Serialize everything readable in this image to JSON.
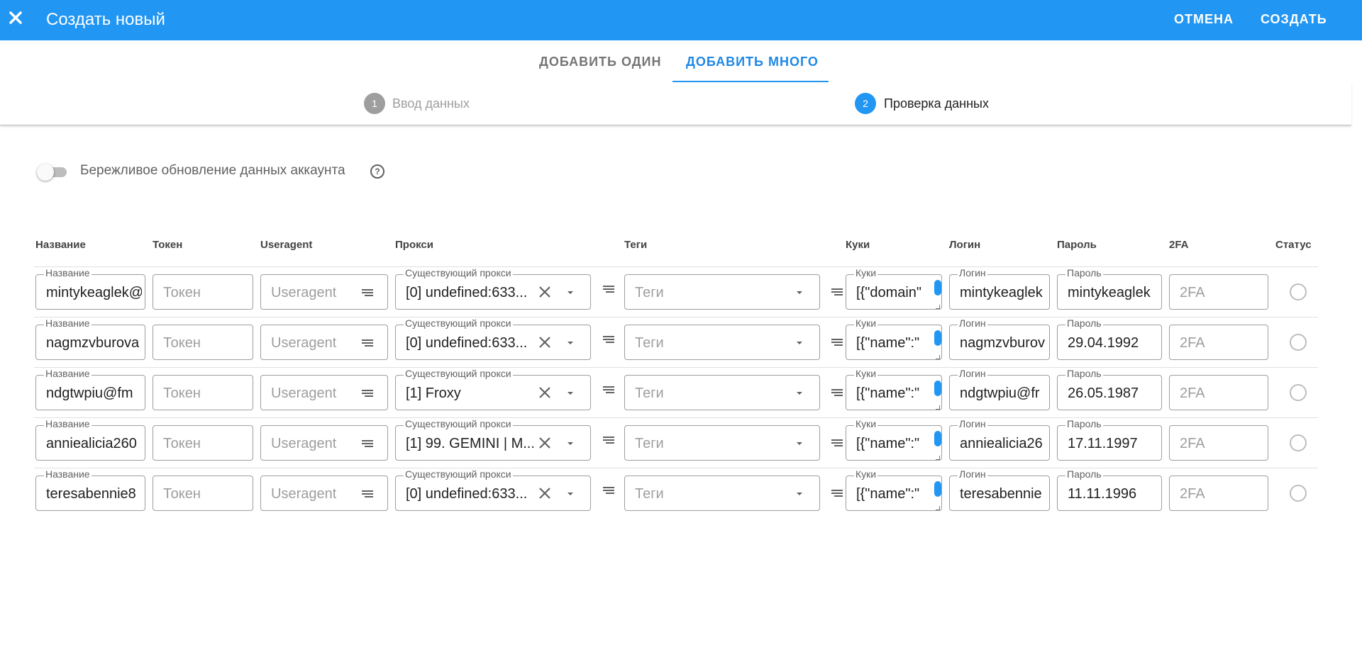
{
  "header": {
    "title": "Создать новый",
    "cancel_label": "ОТМЕНА",
    "create_label": "СОЗДАТЬ"
  },
  "tabs": [
    {
      "label": "ДОБАВИТЬ ОДИН",
      "active": false
    },
    {
      "label": "ДОБАВИТЬ МНОГО",
      "active": true
    }
  ],
  "stepper": [
    {
      "number": "1",
      "label": "Ввод данных",
      "active": false
    },
    {
      "number": "2",
      "label": "Проверка данных",
      "active": true
    }
  ],
  "settings": {
    "toggle_label": "Бережливое обновление данных аккаунта",
    "toggle_on": false,
    "help_glyph": "?"
  },
  "table": {
    "headers": [
      "Название",
      "Токен",
      "Useragent",
      "Прокси",
      "Теги",
      "Куки",
      "Логин",
      "Пароль",
      "2FA",
      "Статус"
    ],
    "field_labels": {
      "name": "Название",
      "proxy": "Существующий прокси",
      "cookies": "Куки",
      "login": "Логин",
      "password": "Пароль"
    },
    "placeholders": {
      "token": "Токен",
      "useragent": "Useragent",
      "tags": "Теги",
      "twofa": "2FA"
    },
    "rows": [
      {
        "name": "mintykeaglek@",
        "proxy": "[0] undefined:633...",
        "cookies": "[{\"domain\"",
        "login": "mintykeaglek",
        "password": "mintykeaglek"
      },
      {
        "name": "nagmzvburova",
        "proxy": "[0] undefined:633...",
        "cookies": "[{\"name\":\"",
        "login": "nagmzvburov",
        "password": "29.04.1992"
      },
      {
        "name": "ndgtwpiu@fm",
        "proxy": "[1] Froxy",
        "cookies": "[{\"name\":\"",
        "login": "ndgtwpiu@fr",
        "password": "26.05.1987"
      },
      {
        "name": "anniealicia260",
        "proxy": "[1] 99. GEMINI | M...",
        "cookies": "[{\"name\":\"",
        "login": "anniealicia26",
        "password": "17.11.1997"
      },
      {
        "name": "teresabennie8",
        "proxy": "[0] undefined:633...",
        "cookies": "[{\"name\":\"",
        "login": "teresabennie",
        "password": "11.11.1996"
      }
    ]
  },
  "icons": {
    "close": "close-icon",
    "lines": "lines-icon",
    "caret": "caret-down-icon",
    "clear": "clear-icon",
    "help": "help-icon",
    "status": "status-radio"
  },
  "colors": {
    "primary": "#2196f3",
    "step_inactive": "#9e9e9e",
    "border": "#9e9e9e"
  }
}
